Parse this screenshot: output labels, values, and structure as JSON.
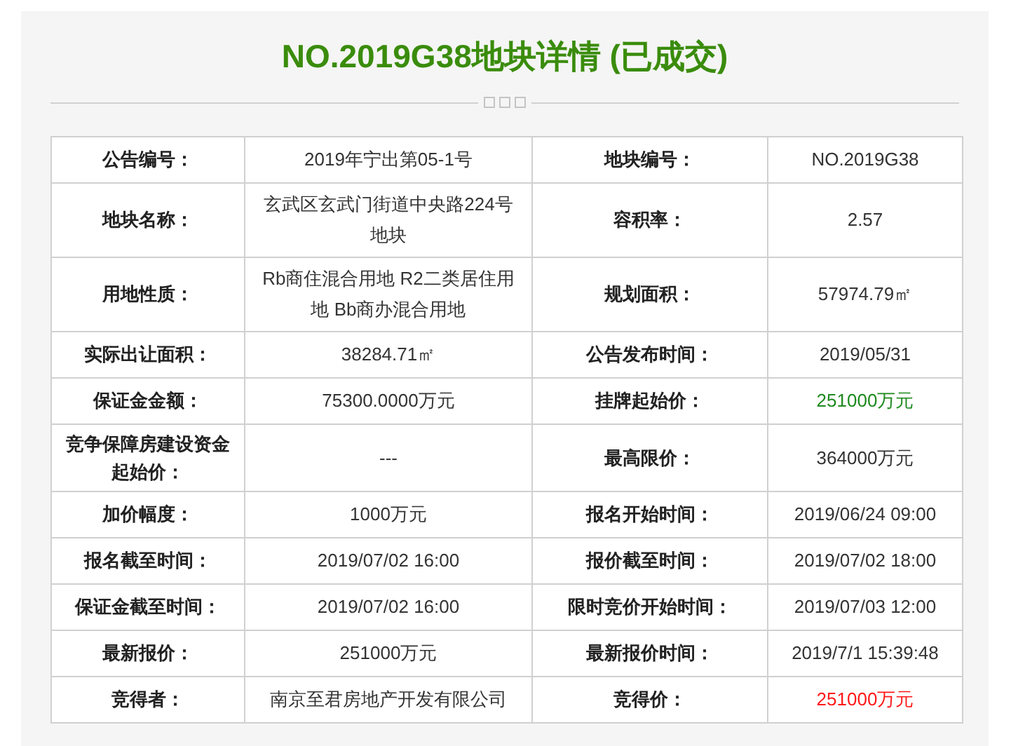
{
  "title": "NO.2019G38地块详情 (已成交)",
  "rows": [
    {
      "left": {
        "label": "公告编号：",
        "value": "2019年宁出第05-1号"
      },
      "right": {
        "label": "地块编号：",
        "value": "NO.2019G38"
      }
    },
    {
      "left": {
        "label": "地块名称：",
        "value": "玄武区玄武门街道中央路224号地块"
      },
      "right": {
        "label": "容积率：",
        "value": "2.57"
      }
    },
    {
      "left": {
        "label": "用地性质：",
        "value": "Rb商住混合用地 R2二类居住用地 Bb商办混合用地"
      },
      "right": {
        "label": "规划面积：",
        "value": "57974.79㎡"
      }
    },
    {
      "left": {
        "label": "实际出让面积：",
        "value": "38284.71㎡"
      },
      "right": {
        "label": "公告发布时间：",
        "value": "2019/05/31"
      }
    },
    {
      "left": {
        "label": "保证金金额：",
        "value": "75300.0000万元"
      },
      "right": {
        "label": "挂牌起始价：",
        "value": "251000万元",
        "color": "#1f8a1f"
      }
    },
    {
      "left": {
        "label": "竞争保障房建设资金起始价：",
        "value": "---"
      },
      "right": {
        "label": "最高限价：",
        "value": "364000万元"
      }
    },
    {
      "left": {
        "label": "加价幅度：",
        "value": "1000万元"
      },
      "right": {
        "label": "报名开始时间：",
        "value": "2019/06/24 09:00"
      }
    },
    {
      "left": {
        "label": "报名截至时间：",
        "value": "2019/07/02 16:00"
      },
      "right": {
        "label": "报价截至时间：",
        "value": "2019/07/02 18:00"
      }
    },
    {
      "left": {
        "label": "保证金截至时间：",
        "value": "2019/07/02 16:00"
      },
      "right": {
        "label": "限时竞价开始时间：",
        "value": "2019/07/03 12:00"
      }
    },
    {
      "left": {
        "label": "最新报价：",
        "value": "251000万元"
      },
      "right": {
        "label": "最新报价时间：",
        "value": "2019/7/1 15:39:48"
      }
    },
    {
      "left": {
        "label": "竞得者：",
        "value": "南京至君房地产开发有限公司"
      },
      "right": {
        "label": "竞得价：",
        "value": "251000万元",
        "color": "#ff1a1a"
      }
    }
  ]
}
